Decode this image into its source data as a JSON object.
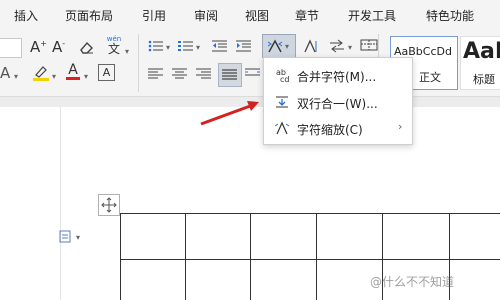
{
  "tabs": [
    "插入",
    "页面布局",
    "引用",
    "审阅",
    "视图",
    "章节",
    "开发工具",
    "特色功能"
  ],
  "ribbon": {
    "wen_label": "wén",
    "wen_char": "文",
    "letter_a": "A",
    "aa_char": "A",
    "styles": {
      "normal_preview": "AaBbCcDd",
      "normal_label": "正文",
      "heading_preview": "AaB",
      "heading_label": "标题"
    }
  },
  "menu": {
    "items": [
      {
        "label": "合并字符(M)...",
        "icon": "merge-chars-icon"
      },
      {
        "label": "双行合一(W)...",
        "icon": "two-lines-in-one-icon"
      },
      {
        "label": "字符缩放(C)",
        "icon": "char-scale-icon",
        "submenu": true
      }
    ],
    "submenu_arrow": "›"
  },
  "watermark": "@什么不不知道",
  "colors": {
    "highlight_yellow": "#f5d000",
    "font_red": "#e02020",
    "arrow_red": "#d42020",
    "selected_blue": "#2a6fd6"
  }
}
